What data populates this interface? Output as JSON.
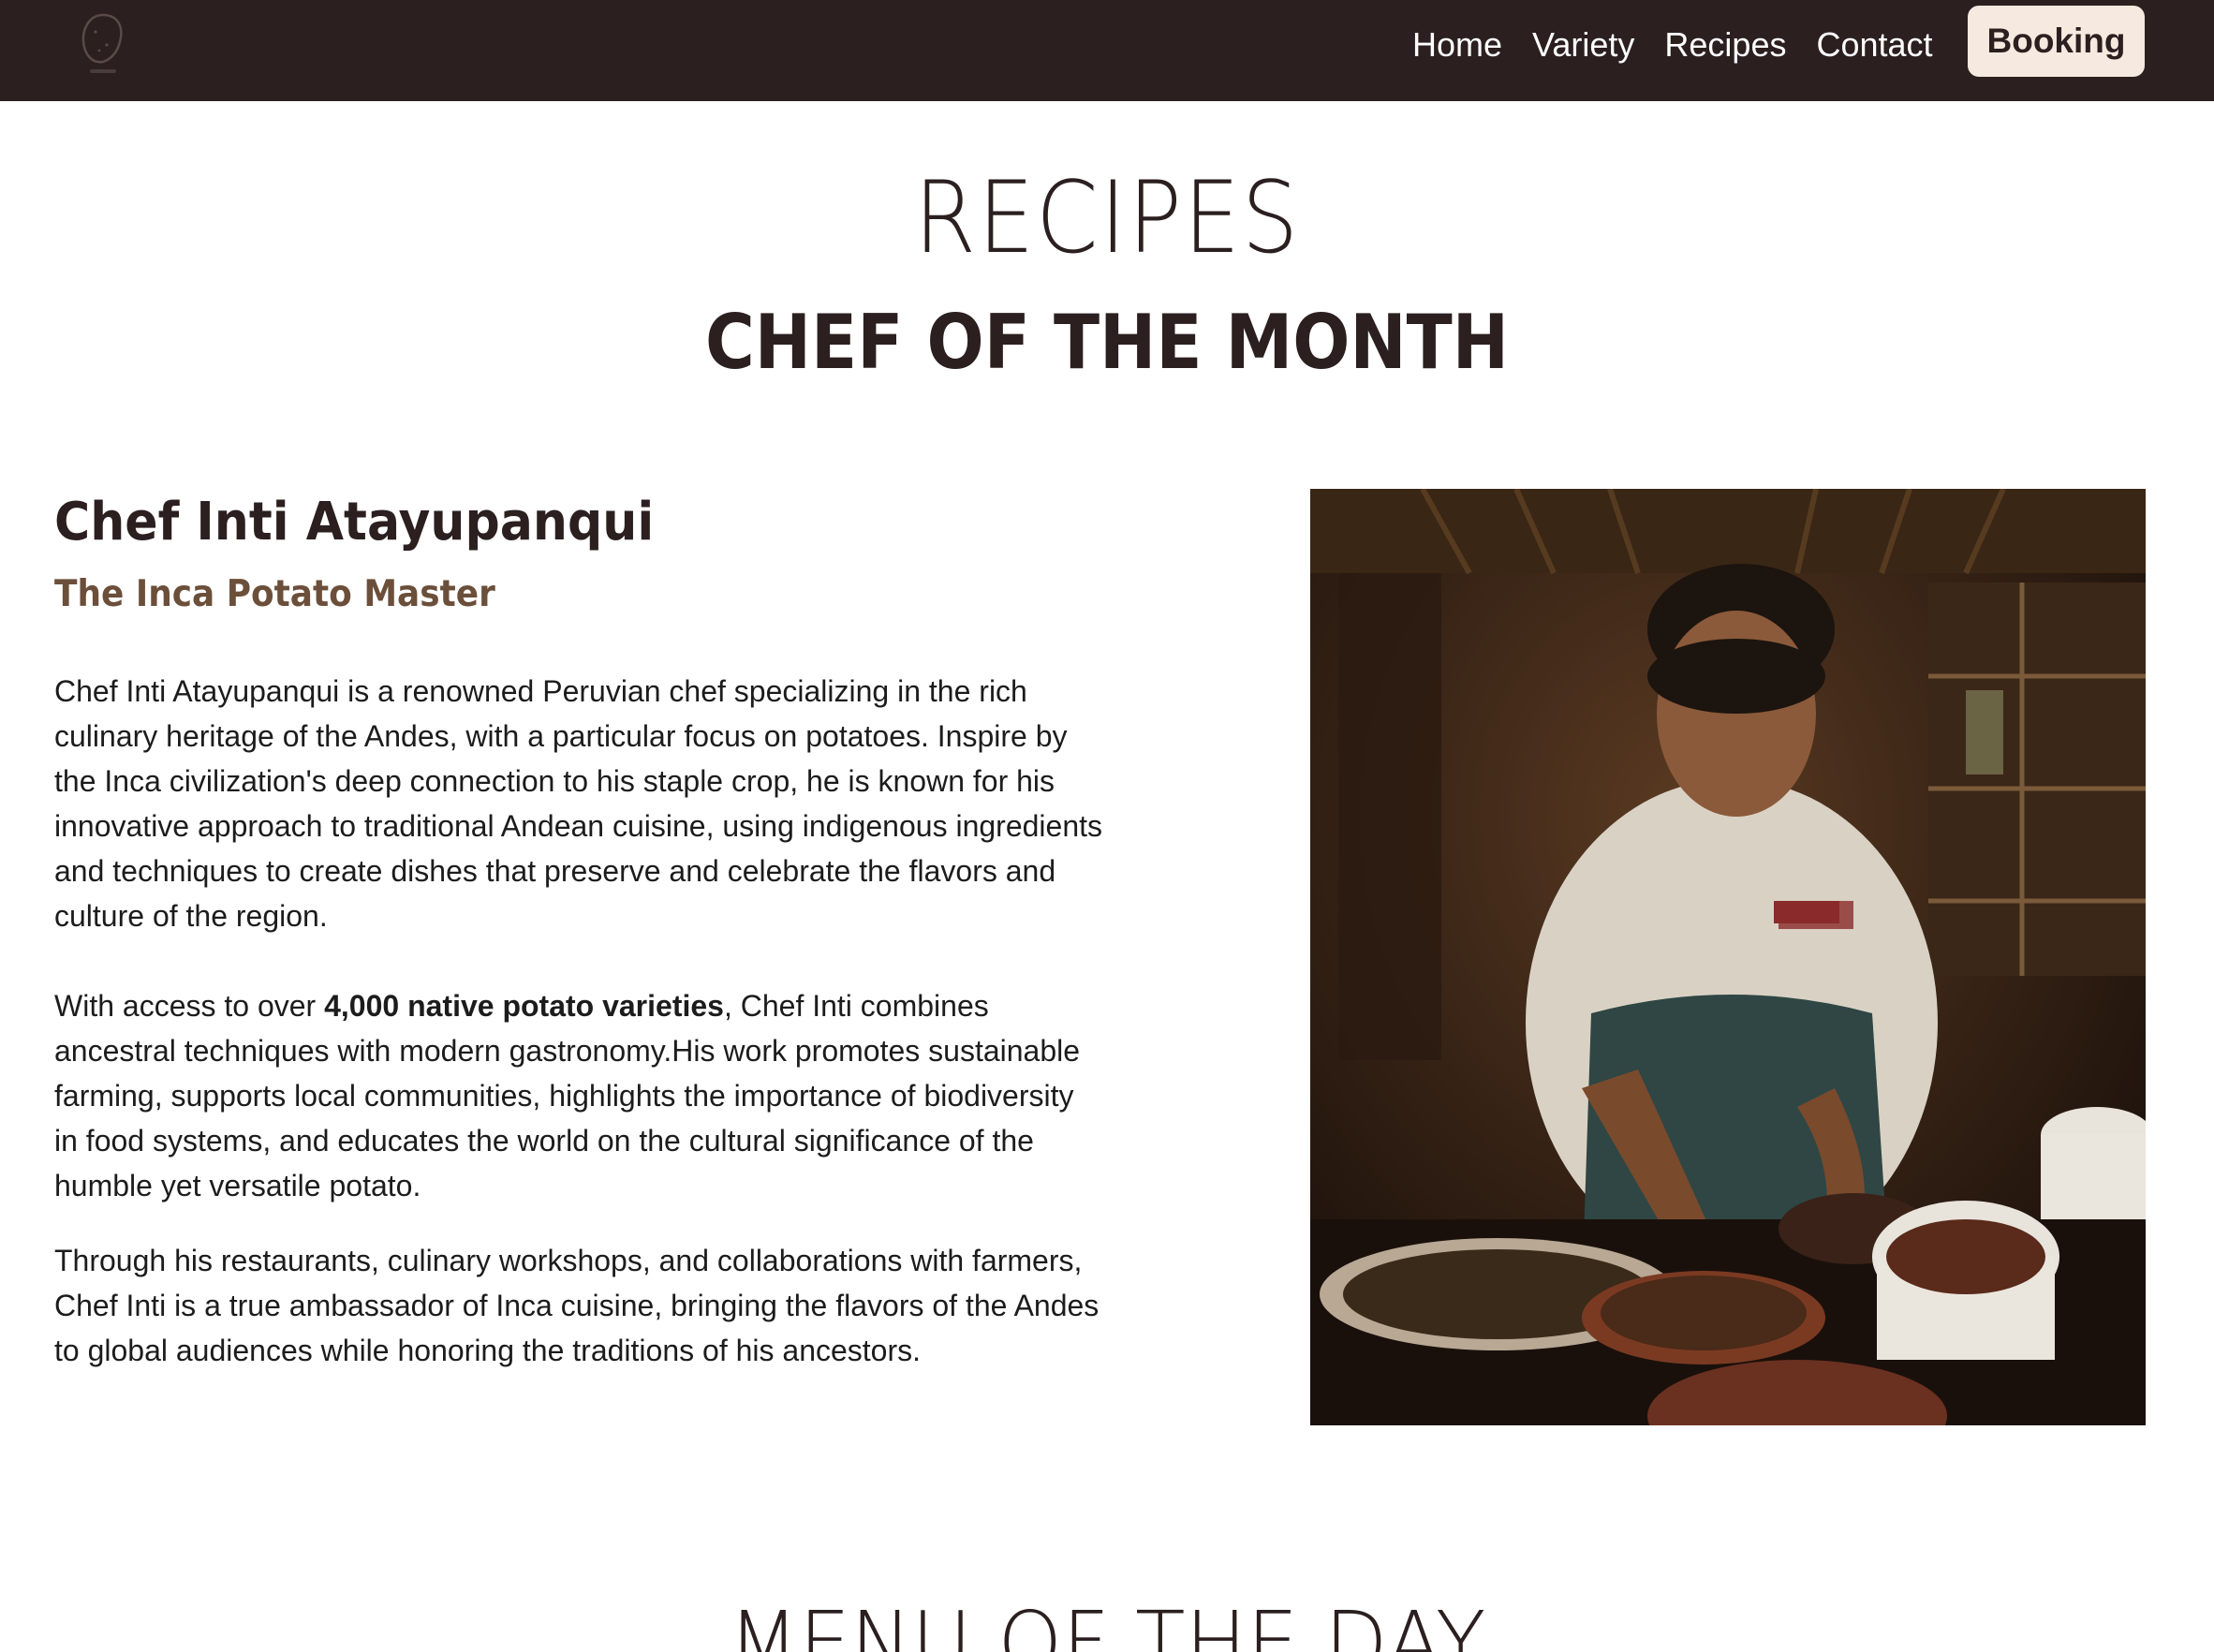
{
  "nav": {
    "logo_icon": "potato-logo-icon",
    "links": [
      "Home",
      "Variety",
      "Recipes",
      "Contact"
    ],
    "booking_label": "Booking"
  },
  "page": {
    "title": "RECIPES",
    "section_title": "CHEF OF THE MONTH",
    "next_section_title": "MENU OF THE DAY"
  },
  "chef": {
    "name": "Chef Inti Atayupanqui",
    "subtitle": "The Inca Potato Master",
    "bio_1": "Chef Inti Atayupanqui is a renowned Peruvian chef specializing in the rich culinary heritage of the Andes, with a particular focus on potatoes. Inspire by the Inca civilization's deep connection to his staple crop, he is known for his innovative approach to traditional Andean cuisine, using indigenous ingredients and techniques to create dishes that preserve and celebrate the flavors and culture of the region.",
    "bio_2_before": "With access to over ",
    "bio_2_bold": "4,000 native potato varieties",
    "bio_2_after": ", Chef Inti combines ancestral techniques with modern gastronomy.His work promotes sustainable farming, supports local communities, highlights the importance of biodiversity in food systems, and educates the world on the cultural significance of the humble yet versatile potato.",
    "bio_3": "Through his restaurants, culinary workshops, and collaborations with farmers, Chef Inti is a true ambassador of Inca cuisine, bringing the flavors of the Andes to global audiences while honoring the traditions of his ancestors."
  },
  "colors": {
    "navbar_bg": "#2b1f1f",
    "booking_bg": "#f6e9df",
    "subtitle": "#6b4f3a"
  }
}
